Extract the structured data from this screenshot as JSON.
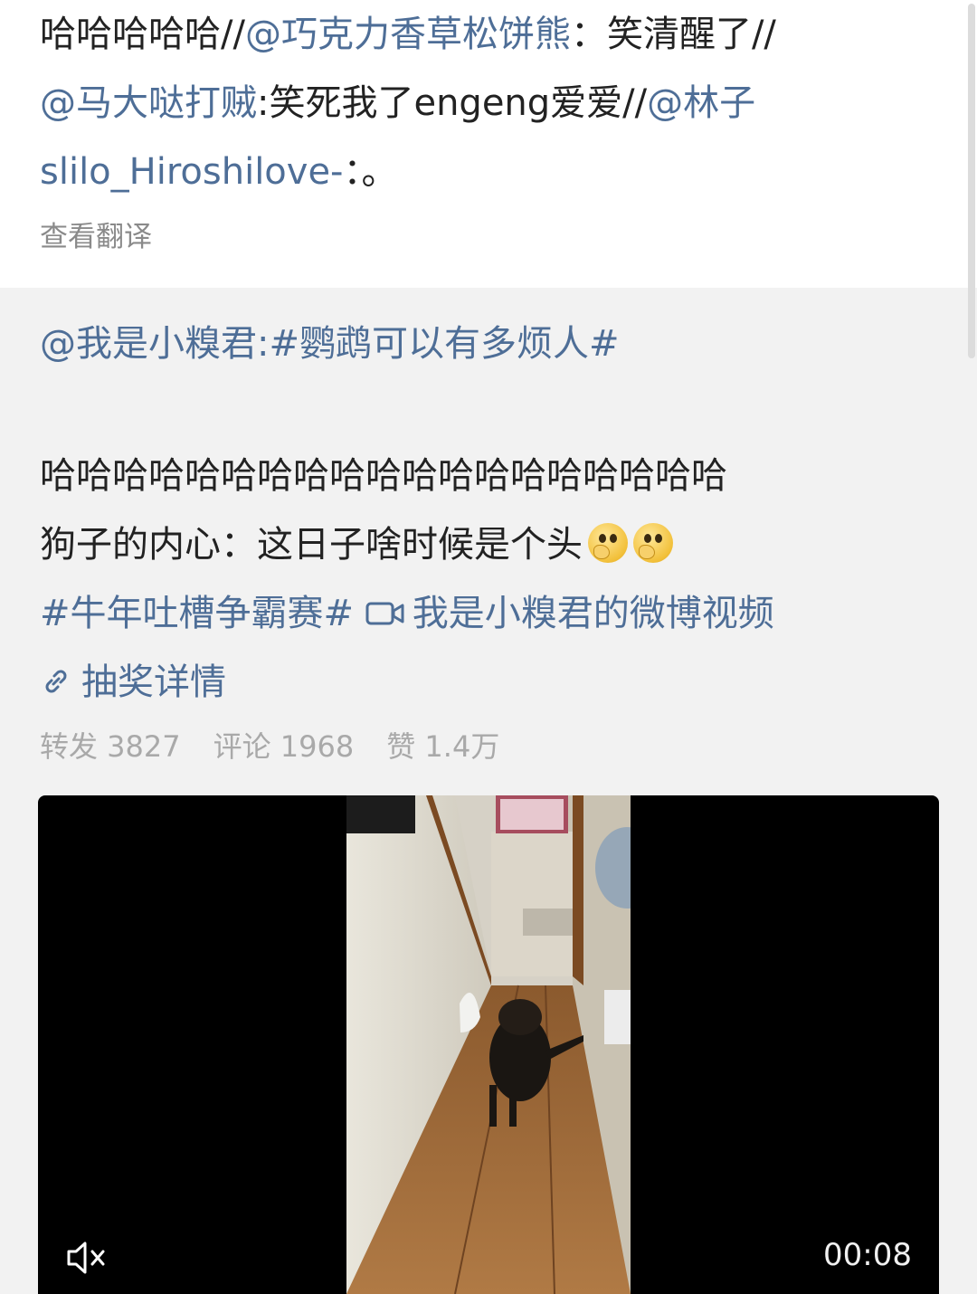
{
  "repost_header": {
    "line1_prefix": "哈哈哈哈哈//",
    "line1_mention": "@巧克力香草松饼熊",
    "line1_suffix": "：笑清醒了//",
    "line2_mention": "@马大哒打贼",
    "line2_text": ":笑死我了engeng爱爱//",
    "line2_mention2": "@林子",
    "line3_mention": "slilo_Hiroshilove-",
    "line3_suffix": "：。",
    "translate_label": "查看翻译"
  },
  "original_post": {
    "author_mention": "@我是小糗君",
    "topic_title": ":#鹦鹉可以有多烦人#",
    "text_line1": "哈哈哈哈哈哈哈哈哈哈哈哈哈哈哈哈哈哈哈",
    "text_line2": "狗子的内心：这日子啥时候是个头",
    "emoji_name": "thinking-face",
    "hashtag": "#牛年吐槽争霸赛#",
    "video_link": "我是小糗君的微博视频",
    "lottery_link": "抽奖详情"
  },
  "stats": {
    "repost": "转发 3827",
    "comment": "评论 1968",
    "like": "赞 1.4万"
  },
  "video": {
    "duration": "00:08",
    "mute_icon": "speaker-muted-icon"
  },
  "colors": {
    "link": "#4e6e97",
    "meta": "#a9a9a9"
  }
}
